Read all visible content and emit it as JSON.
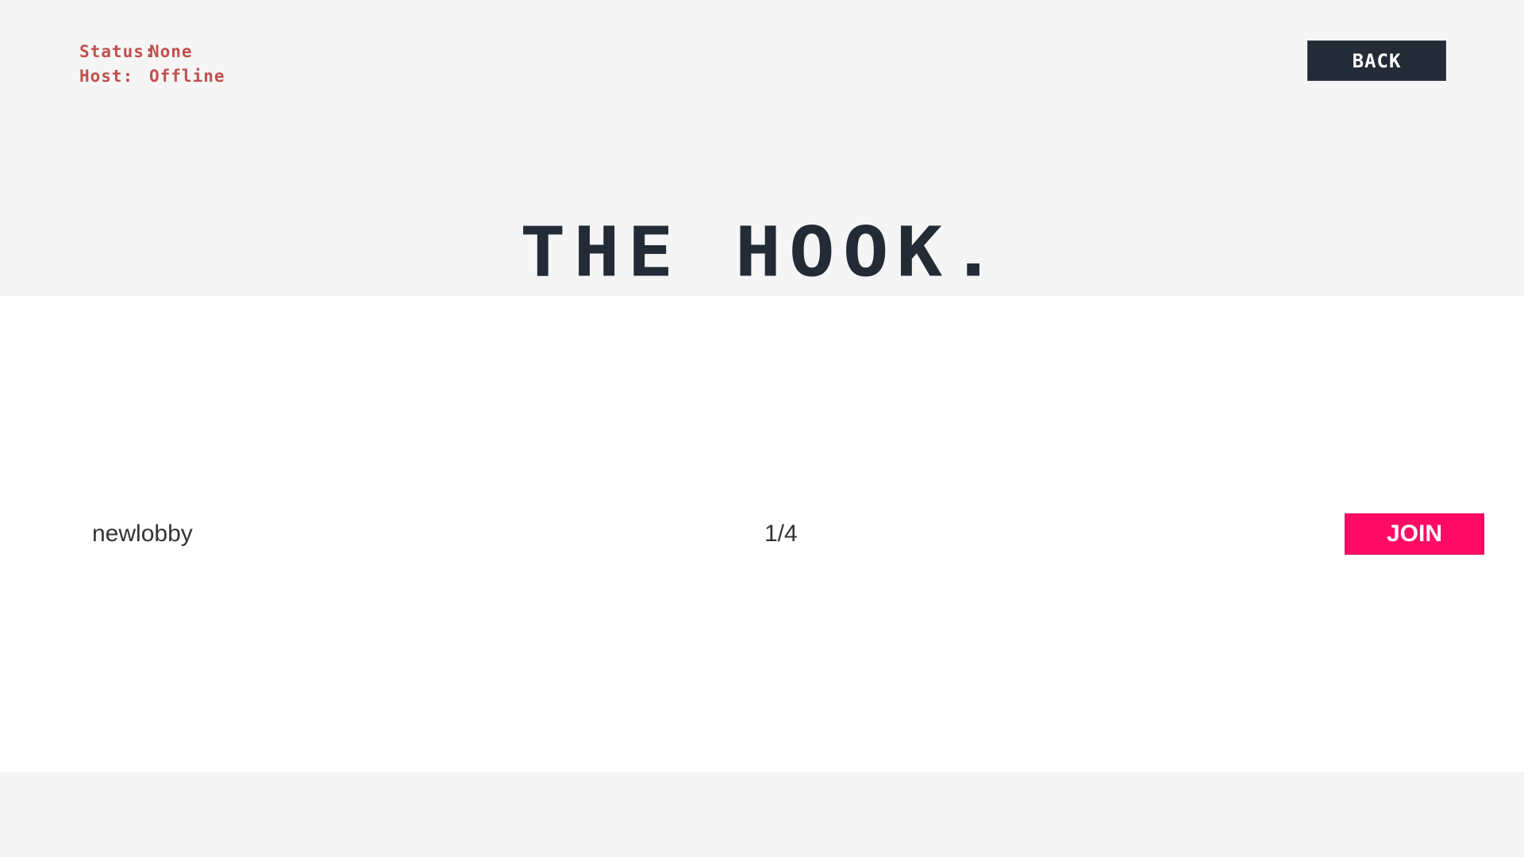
{
  "status": {
    "rows": [
      {
        "key": "Status:",
        "value": "None"
      },
      {
        "key": "Host:",
        "value": "Offline"
      }
    ]
  },
  "header": {
    "back_label": "BACK",
    "title": "THE HOOK."
  },
  "lobbies": [
    {
      "name": "newlobby",
      "players": "1/4",
      "join_label": "JOIN"
    }
  ],
  "colors": {
    "background": "#f5f5f5",
    "panel": "#ffffff",
    "dark": "#222b36",
    "status_text": "#c0504d",
    "join_accent": "#ff0a65"
  }
}
